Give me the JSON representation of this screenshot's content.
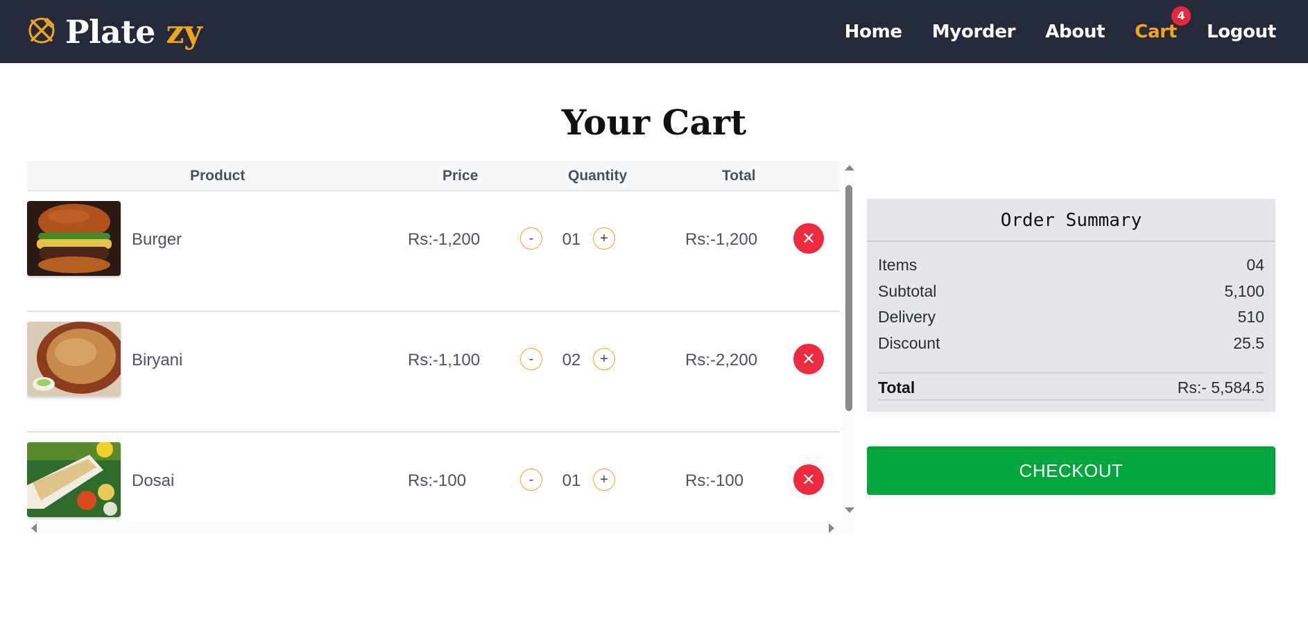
{
  "brand": {
    "name_main": "Plate ",
    "name_accent": "zy",
    "logo_icon": "utensils-logo-icon",
    "accent_color": "#f2a41f"
  },
  "nav": {
    "items": [
      {
        "label": "Home",
        "active": false
      },
      {
        "label": "Myorder",
        "active": false
      },
      {
        "label": "About",
        "active": false
      },
      {
        "label": "Cart",
        "active": true,
        "badge": "4"
      },
      {
        "label": "Logout",
        "active": false
      }
    ]
  },
  "page": {
    "title": "Your Cart"
  },
  "cart": {
    "columns": [
      "Product",
      "Price",
      "Quantity",
      "Total"
    ],
    "items": [
      {
        "name": "Burger",
        "price": "Rs:-1,200",
        "quantity": "01",
        "total": "Rs:-1,200",
        "image": "burger-image"
      },
      {
        "name": "Biryani",
        "price": "Rs:-1,100",
        "quantity": "02",
        "total": "Rs:-2,200",
        "image": "biryani-image"
      },
      {
        "name": "Dosai",
        "price": "Rs:-100",
        "quantity": "01",
        "total": "Rs:-100",
        "image": "dosai-image"
      }
    ],
    "decrement_label": "-",
    "increment_label": "+",
    "remove_icon": "close-icon",
    "remove_color": "#ee2a3f"
  },
  "summary": {
    "title": "Order Summary",
    "rows": [
      {
        "label": "Items",
        "value": "04"
      },
      {
        "label": "Subtotal",
        "value": "5,100"
      },
      {
        "label": "Delivery",
        "value": "510"
      },
      {
        "label": "Discount",
        "value": "25.5"
      }
    ],
    "total_label": "Total",
    "total_value": "Rs:- 5,584.5"
  },
  "checkout": {
    "label": "CHECKOUT",
    "color": "#04a63f"
  }
}
